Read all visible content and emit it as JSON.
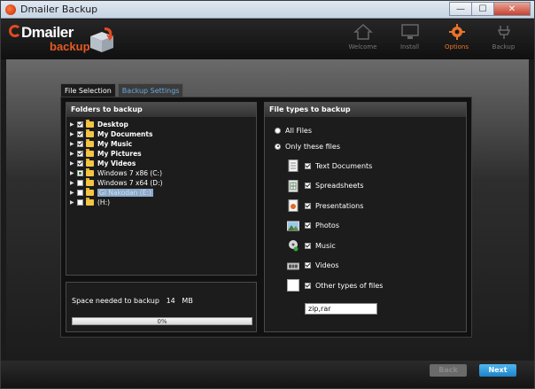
{
  "window": {
    "title": "Dmailer Backup",
    "controls": [
      "—",
      "☐",
      "✕"
    ]
  },
  "logo": {
    "word1": "Dmailer",
    "word2": "backup"
  },
  "nav": [
    {
      "label": "Welcome",
      "icon": "home-icon",
      "active": false
    },
    {
      "label": "Install",
      "icon": "monitor-icon",
      "active": false
    },
    {
      "label": "Options",
      "icon": "gear-icon",
      "active": true
    },
    {
      "label": "Backup",
      "icon": "plug-icon",
      "active": false
    }
  ],
  "tabs": {
    "file_selection": "File Selection",
    "backup_settings": "Backup Settings"
  },
  "folders": {
    "header": "Folders to backup",
    "items": [
      {
        "label": "Desktop",
        "checked": "on",
        "bold": true
      },
      {
        "label": "My Documents",
        "checked": "on",
        "bold": true
      },
      {
        "label": "My Music",
        "checked": "on",
        "bold": true
      },
      {
        "label": "My Pictures",
        "checked": "on",
        "bold": true
      },
      {
        "label": "My Videos",
        "checked": "on",
        "bold": true
      },
      {
        "label": "Windows 7 x86 (C:)",
        "checked": "partial",
        "bold": false
      },
      {
        "label": "Windows 7 x64 (D:)",
        "checked": "off",
        "bold": false
      },
      {
        "label": "GI Nakodan (E:)",
        "checked": "off",
        "bold": false,
        "selected": true
      },
      {
        "label": "(H:)",
        "checked": "off",
        "bold": false
      }
    ]
  },
  "filetypes": {
    "header": "File types to backup",
    "all_files": "All Files",
    "only_these": "Only these files",
    "items": [
      {
        "label": "Text Documents",
        "icon": "text-document-icon"
      },
      {
        "label": "Spreadsheets",
        "icon": "spreadsheet-icon"
      },
      {
        "label": "Presentations",
        "icon": "presentation-icon"
      },
      {
        "label": "Photos",
        "icon": "photo-icon"
      },
      {
        "label": "Music",
        "icon": "music-icon"
      },
      {
        "label": "Videos",
        "icon": "video-icon"
      },
      {
        "label": "Other types of files",
        "icon": "other-file-icon"
      }
    ],
    "other_extensions": "zip,rar"
  },
  "space": {
    "label": "Space needed to backup",
    "amount": "14",
    "unit": "MB",
    "progress_text": "0%",
    "progress_value": 0
  },
  "footer": {
    "back": "Back",
    "next": "Next"
  }
}
